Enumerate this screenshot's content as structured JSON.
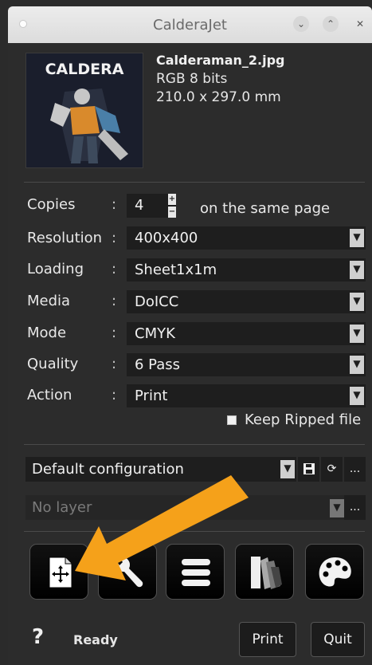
{
  "window": {
    "title": "CalderaJet"
  },
  "file": {
    "thumbnail_caption": "CALDERA",
    "name": "Calderaman_2.jpg",
    "color_depth": "RGB 8 bits",
    "dimensions": "210.0 x 297.0 mm"
  },
  "settings": {
    "copies": {
      "label": "Copies",
      "value": "4",
      "suffix": "on the same page"
    },
    "resolution": {
      "label": "Resolution",
      "value": "400x400"
    },
    "loading": {
      "label": "Loading",
      "value": "Sheet1x1m"
    },
    "media": {
      "label": "Media",
      "value": "DoICC"
    },
    "mode": {
      "label": "Mode",
      "value": "CMYK"
    },
    "quality": {
      "label": "Quality",
      "value": "6 Pass"
    },
    "action": {
      "label": "Action",
      "value": "Print"
    },
    "separator": ":",
    "keep_ripped": {
      "label": "Keep Ripped file",
      "checked": false
    }
  },
  "configuration": {
    "value": "Default configuration",
    "more_label": "..."
  },
  "layer": {
    "value": "No layer",
    "more_label": "..."
  },
  "tools": [
    {
      "icon": "layout-move-icon"
    },
    {
      "icon": "wrench-icon"
    },
    {
      "icon": "menu-lines-icon"
    },
    {
      "icon": "color-swatch-icon"
    },
    {
      "icon": "palette-icon"
    }
  ],
  "footer": {
    "help_label": "?",
    "status": "Ready",
    "print_label": "Print",
    "quit_label": "Quit"
  },
  "colors": {
    "highlight_arrow": "#f5a11a",
    "background": "#2c2c2c",
    "field": "#1e1e1e"
  }
}
